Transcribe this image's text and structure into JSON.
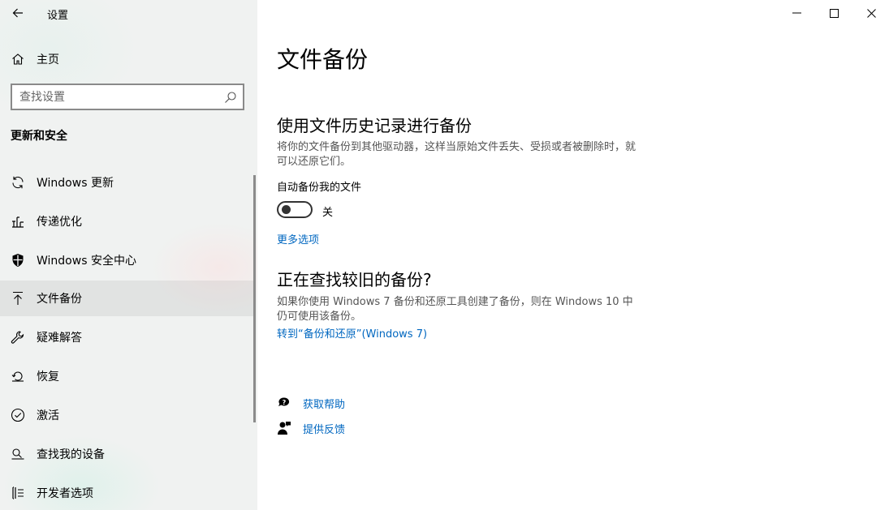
{
  "app": {
    "title": "设置"
  },
  "sidebar": {
    "home_label": "主页",
    "search_placeholder": "查找设置",
    "section_heading": "更新和安全",
    "items": [
      {
        "label": "Windows 更新",
        "icon": "refresh-icon"
      },
      {
        "label": "传递优化",
        "icon": "delivery-optimization-icon"
      },
      {
        "label": "Windows 安全中心",
        "icon": "shield-icon"
      },
      {
        "label": "文件备份",
        "icon": "backup-arrow-icon",
        "selected": true
      },
      {
        "label": "疑难解答",
        "icon": "wrench-icon"
      },
      {
        "label": "恢复",
        "icon": "recovery-icon"
      },
      {
        "label": "激活",
        "icon": "checkmark-circle-icon"
      },
      {
        "label": "查找我的设备",
        "icon": "find-device-icon"
      },
      {
        "label": "开发者选项",
        "icon": "developer-icon"
      }
    ]
  },
  "main": {
    "title": "文件备份",
    "file_history": {
      "heading": "使用文件历史记录进行备份",
      "description": "将你的文件备份到其他驱动器，这样当原始文件丢失、受损或者被删除时，就可以还原它们。",
      "toggle_label": "自动备份我的文件",
      "toggle_state": "关",
      "toggle_on": false,
      "more_options": "更多选项"
    },
    "older_backup": {
      "heading": "正在查找较旧的备份?",
      "description": "如果你使用 Windows 7 备份和还原工具创建了备份，则在 Windows 10 中仍可使用该备份。",
      "link": "转到“备份和还原”(Windows 7)"
    },
    "help": {
      "get_help": "获取帮助",
      "feedback": "提供反馈"
    }
  },
  "colors": {
    "accent": "#0067c0",
    "sidebar_bg": "#f0f2f1"
  }
}
